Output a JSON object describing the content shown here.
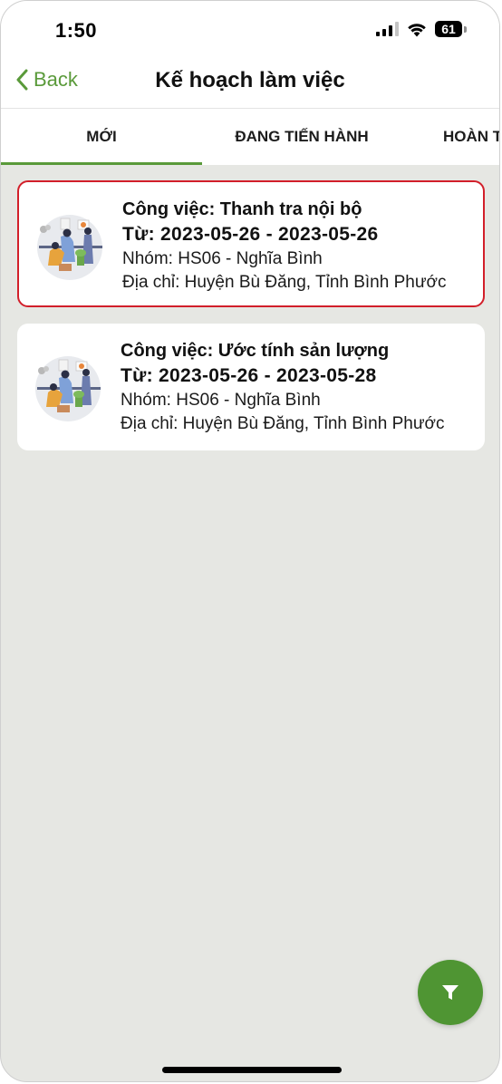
{
  "status_bar": {
    "time": "1:50",
    "battery": "61"
  },
  "nav": {
    "back_label": "Back",
    "title": "Kế hoạch làm việc"
  },
  "tabs": [
    {
      "label": "MỚI",
      "active": true
    },
    {
      "label": "ĐANG TIẾN HÀNH",
      "active": false
    },
    {
      "label": "HOÀN T",
      "active": false
    }
  ],
  "tasks": [
    {
      "title": "Công việc: Thanh tra nội bộ",
      "dates": "Từ: 2023-05-26 - 2023-05-26",
      "group": "Nhóm: HS06 - Nghĩa Bình",
      "address": "Địa chỉ: Huyện Bù Đăng, Tỉnh Bình Phước",
      "selected": true,
      "image_icon": "team-meeting-illustration"
    },
    {
      "title": "Công việc: Ước tính sản lượng",
      "dates": "Từ: 2023-05-26 - 2023-05-28",
      "group": "Nhóm: HS06 - Nghĩa Bình",
      "address": "Địa chỉ: Huyện Bù Đăng, Tỉnh Bình Phước",
      "selected": false,
      "image_icon": "team-meeting-illustration"
    }
  ],
  "fab": {
    "icon": "filter-icon"
  },
  "colors": {
    "accent": "#5a9a3a",
    "selected_border": "#d21f2a",
    "fab": "#4f9533",
    "background": "#e6e7e3"
  }
}
